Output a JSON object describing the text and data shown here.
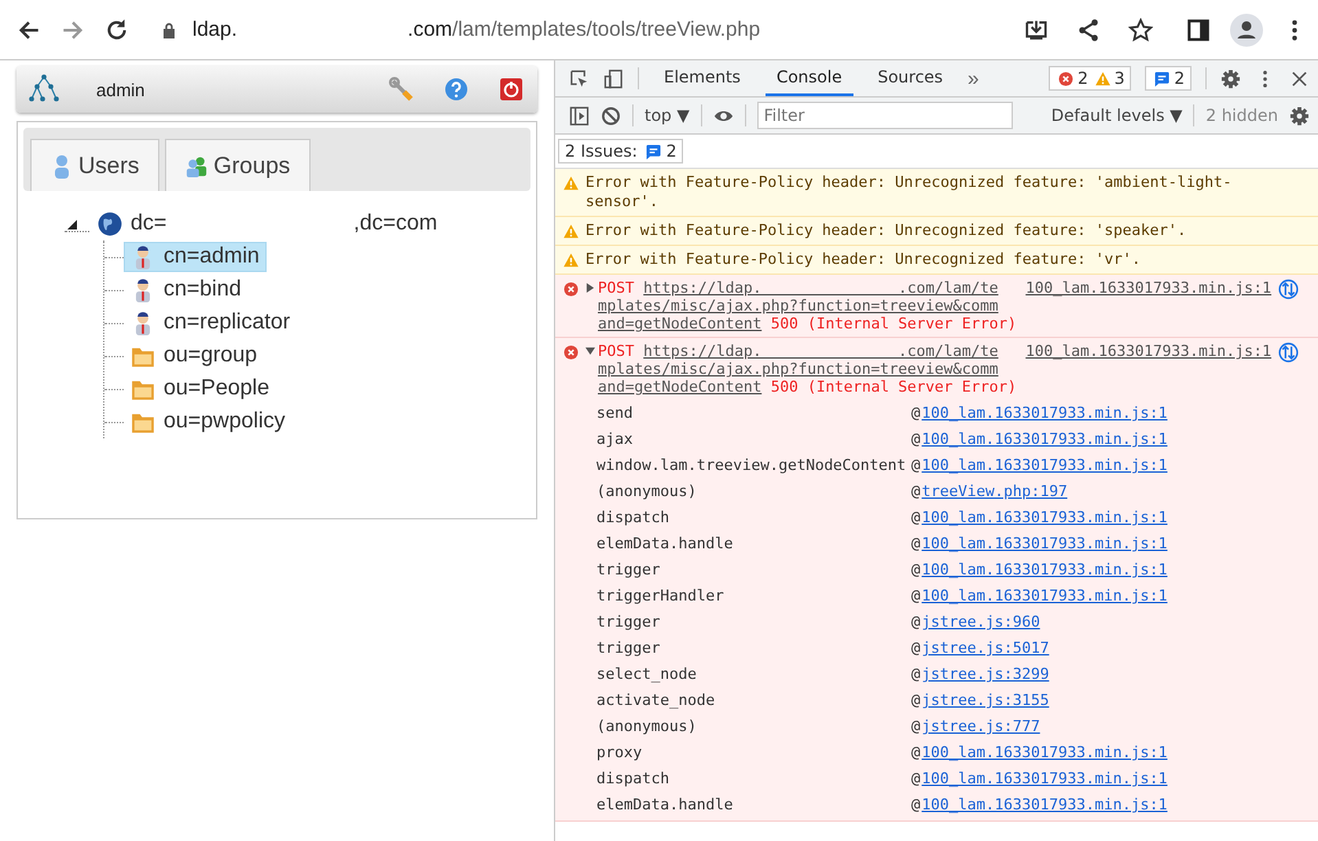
{
  "browser": {
    "host": "ldap.",
    "domain": ".com",
    "path": "/lam/templates/tools/treeView.php"
  },
  "app": {
    "user": "admin",
    "tabs": [
      {
        "label": "Users",
        "kind": "users"
      },
      {
        "label": "Groups",
        "kind": "groups"
      }
    ],
    "tree": {
      "label_start": "dc=",
      "label_end": ",dc=com",
      "expanded": true,
      "children": [
        {
          "label": "cn=admin",
          "kind": "user",
          "selected": true
        },
        {
          "label": "cn=bind",
          "kind": "user",
          "selected": false
        },
        {
          "label": "cn=replicator",
          "kind": "user",
          "selected": false
        },
        {
          "label": "ou=group",
          "kind": "folder",
          "selected": false
        },
        {
          "label": "ou=People",
          "kind": "folder",
          "selected": false
        },
        {
          "label": "ou=pwpolicy",
          "kind": "folder",
          "selected": false
        }
      ]
    }
  },
  "devtools": {
    "tabs": [
      {
        "label": "Elements",
        "selected": false
      },
      {
        "label": "Console",
        "selected": true
      },
      {
        "label": "Sources",
        "selected": false
      }
    ],
    "more": "»",
    "errors": "2",
    "warnings": "3",
    "infos": "2",
    "context": "top ▼",
    "filter_placeholder": "Filter",
    "levels": "Default levels ▼",
    "hidden": "2 hidden",
    "issues_label": "2 Issues:",
    "issues_count": "2",
    "messages": [
      {
        "kind": "warning",
        "text": "Error with Feature-Policy header: Unrecognized feature: 'ambient-light-sensor'."
      },
      {
        "kind": "warning",
        "text": "Error with Feature-Policy header: Unrecognized feature: 'speaker'."
      },
      {
        "kind": "warning",
        "text": "Error with Feature-Policy header: Unrecognized feature: 'vr'."
      },
      {
        "kind": "error",
        "expanded": false,
        "method": "POST",
        "url": "https://ldap.               .com/lam/templates/misc/ajax.php?function=treeview&command=getNodeContent",
        "status": "500 (Internal Server Error)",
        "source": "100_lam.1633017933.min.js:1"
      },
      {
        "kind": "error",
        "expanded": true,
        "method": "POST",
        "url": "https://ldap.               .com/lam/templates/misc/ajax.php?function=treeview&command=getNodeContent",
        "status": "500 (Internal Server Error)",
        "source": "100_lam.1633017933.min.js:1",
        "stack": [
          {
            "fn": "send",
            "at": "@",
            "file": "100_lam.1633017933.min.js:1"
          },
          {
            "fn": "ajax",
            "at": "@",
            "file": "100_lam.1633017933.min.js:1"
          },
          {
            "fn": "window.lam.treeview.getNodeContent",
            "at": "@",
            "file": "100_lam.1633017933.min.js:1"
          },
          {
            "fn": "(anonymous)",
            "at": "@",
            "file": "treeView.php:197"
          },
          {
            "fn": "dispatch",
            "at": "@",
            "file": "100_lam.1633017933.min.js:1"
          },
          {
            "fn": "elemData.handle",
            "at": "@",
            "file": "100_lam.1633017933.min.js:1"
          },
          {
            "fn": "trigger",
            "at": "@",
            "file": "100_lam.1633017933.min.js:1"
          },
          {
            "fn": "triggerHandler",
            "at": "@",
            "file": "100_lam.1633017933.min.js:1"
          },
          {
            "fn": "trigger",
            "at": "@",
            "file": "jstree.js:960"
          },
          {
            "fn": "trigger",
            "at": "@",
            "file": "jstree.js:5017"
          },
          {
            "fn": "select_node",
            "at": "@",
            "file": "jstree.js:3299"
          },
          {
            "fn": "activate_node",
            "at": "@",
            "file": "jstree.js:3155"
          },
          {
            "fn": "(anonymous)",
            "at": "@",
            "file": "jstree.js:777"
          },
          {
            "fn": "proxy",
            "at": "@",
            "file": "100_lam.1633017933.min.js:1"
          },
          {
            "fn": "dispatch",
            "at": "@",
            "file": "100_lam.1633017933.min.js:1"
          },
          {
            "fn": "elemData.handle",
            "at": "@",
            "file": "100_lam.1633017933.min.js:1"
          }
        ]
      }
    ]
  }
}
